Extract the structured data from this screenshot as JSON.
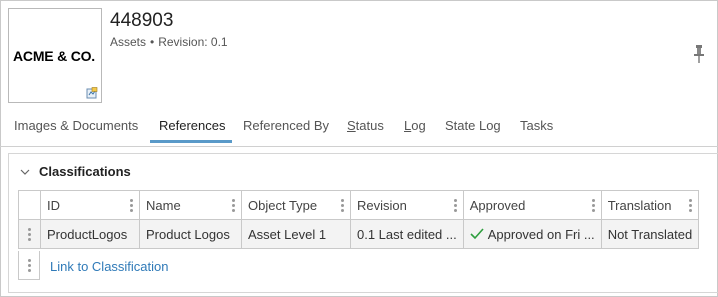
{
  "header": {
    "title": "448903",
    "subtitle_type": "Assets",
    "subtitle_sep": "•",
    "subtitle_revision": "Revision: 0.1",
    "logo_text": "ACME & CO.",
    "thumbnail_icon": "asset-badge-icon",
    "pin_icon": "pin-icon"
  },
  "tabs": [
    {
      "label": "Images & Documents",
      "active": false
    },
    {
      "label": "References",
      "active": true
    },
    {
      "label": "Referenced By",
      "active": false
    },
    {
      "label_ul": "S",
      "label_rest": "tatus",
      "active": false
    },
    {
      "label_ul": "L",
      "label_rest": "og",
      "active": false
    },
    {
      "label": "State Log",
      "active": false
    },
    {
      "label": "Tasks",
      "active": false
    }
  ],
  "section": {
    "title": "Classifications",
    "expanded": true,
    "columns": [
      "ID",
      "Name",
      "Object Type",
      "Revision",
      "Approved",
      "Translation"
    ],
    "rows": [
      {
        "id": "ProductLogos",
        "name": "Product Logos",
        "object_type": "Asset Level 1",
        "revision": "0.1 Last edited ...",
        "approved": "Approved on Fri ...",
        "translation": "Not Translated"
      }
    ],
    "link_label": "Link to Classification"
  },
  "colors": {
    "accent": "#5a9ac9",
    "link": "#2f7ab8",
    "approved_check": "#2e9e3e"
  }
}
